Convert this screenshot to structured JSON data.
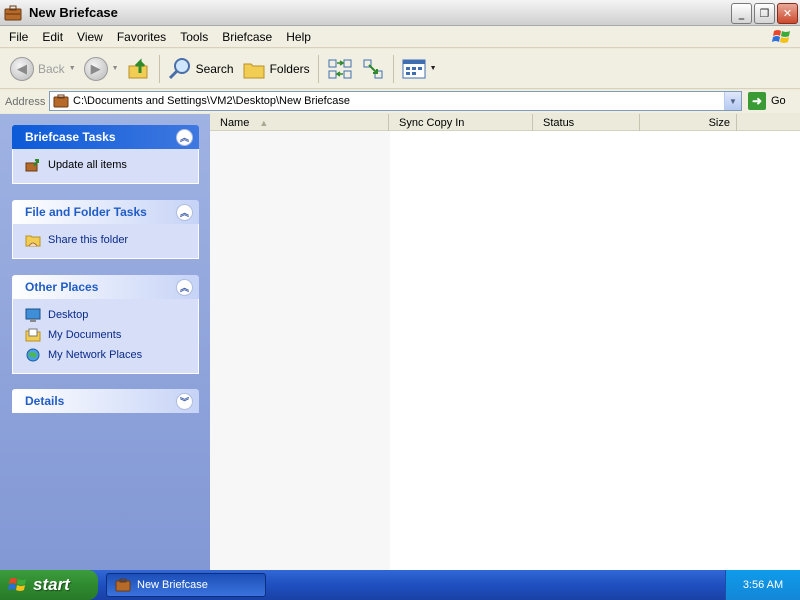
{
  "window": {
    "title": "New Briefcase",
    "controls": {
      "minimize": "_",
      "restore": "❐",
      "close": "✕"
    }
  },
  "menu": [
    "File",
    "Edit",
    "View",
    "Favorites",
    "Tools",
    "Briefcase",
    "Help"
  ],
  "toolbar": {
    "back_label": "Back",
    "search_label": "Search",
    "folders_label": "Folders"
  },
  "address": {
    "label": "Address",
    "path": "C:\\Documents and Settings\\VM2\\Desktop\\New Briefcase",
    "go_label": "Go"
  },
  "task_panels": [
    {
      "title": "Briefcase Tasks",
      "style": "dark",
      "items": [
        {
          "label": "Update all items",
          "icon": "update-briefcase-icon"
        }
      ]
    },
    {
      "title": "File and Folder Tasks",
      "style": "light",
      "items": [
        {
          "label": "Share this folder",
          "icon": "share-folder-icon"
        }
      ]
    },
    {
      "title": "Other Places",
      "style": "light",
      "items": [
        {
          "label": "Desktop",
          "icon": "desktop-icon"
        },
        {
          "label": "My Documents",
          "icon": "my-documents-icon"
        },
        {
          "label": "My Network Places",
          "icon": "network-places-icon"
        }
      ]
    },
    {
      "title": "Details",
      "style": "light",
      "items": []
    }
  ],
  "columns": {
    "name": "Name",
    "sync": "Sync Copy In",
    "status": "Status",
    "size": "Size"
  },
  "taskbar": {
    "start_label": "start",
    "window_button": "New Briefcase",
    "clock": "3:56 AM"
  },
  "colors": {
    "accent": "#215dc6",
    "taskbar": "#245edb",
    "start": "#3a9a3a"
  }
}
